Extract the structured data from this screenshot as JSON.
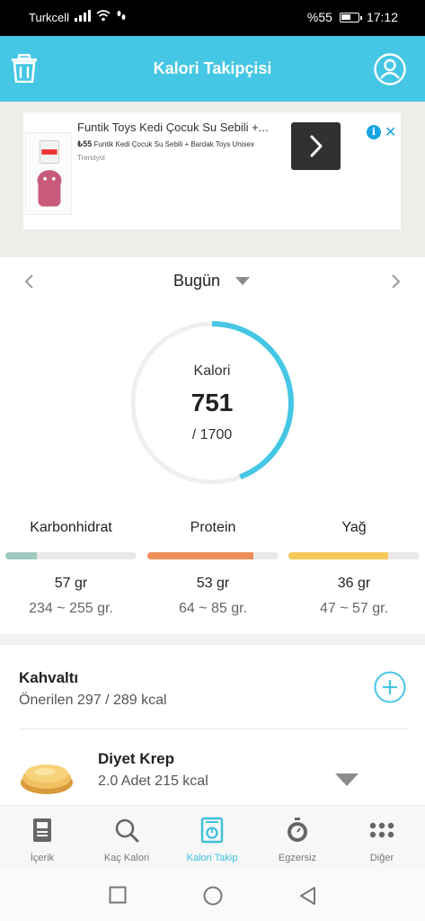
{
  "status_bar": {
    "carrier": "Turkcell",
    "battery": "%55",
    "time": "17:12"
  },
  "app_bar": {
    "title": "Kalori Takipçisi",
    "left_icon": "trash-icon",
    "right_icon": "user-icon"
  },
  "ad": {
    "title": "Funtik Toys Kedi Çocuk Su Sebili +...",
    "price": "₺55",
    "description": "Funtik Kedi Çocuk Su Sebili + Bardak Toys Unisex",
    "seller": "Trendyol",
    "info_label": "i",
    "close_label": "✕"
  },
  "day_selector": {
    "label": "Bugün"
  },
  "calories": {
    "label": "Kalori",
    "consumed": "751",
    "goal": "/ 1700",
    "progress": 0.4418,
    "ring_color": "#45c6e4"
  },
  "macros": [
    {
      "name": "Karbonhidrat",
      "grams": "57 gr",
      "range": "234 ~ 255 gr.",
      "progress": 0.24,
      "color": "#9ecabf"
    },
    {
      "name": "Protein",
      "grams": "53 gr",
      "range": "64 ~ 85 gr.",
      "progress": 0.81,
      "color": "#f08f5c"
    },
    {
      "name": "Yağ",
      "grams": "36 gr",
      "range": "47 ~ 57 gr.",
      "progress": 0.76,
      "color": "#f6c95b"
    }
  ],
  "meal": {
    "title": "Kahvaltı",
    "subtitle": "Önerilen 297 / 289 kcal"
  },
  "food": {
    "name": "Diyet Krep",
    "detail": "2.0 Adet 215 kcal"
  },
  "bottom_nav": [
    {
      "label": "İçerik",
      "icon": "book-icon"
    },
    {
      "label": "Kaç Kalori",
      "icon": "search-icon"
    },
    {
      "label": "Kalori Takip",
      "icon": "scale-icon",
      "active": true
    },
    {
      "label": "Egzersiz",
      "icon": "stopwatch-icon"
    },
    {
      "label": "Diğer",
      "icon": "grid-icon"
    }
  ],
  "colors": {
    "accent": "#45c6e4",
    "nav_active": "#3cc0dd"
  }
}
